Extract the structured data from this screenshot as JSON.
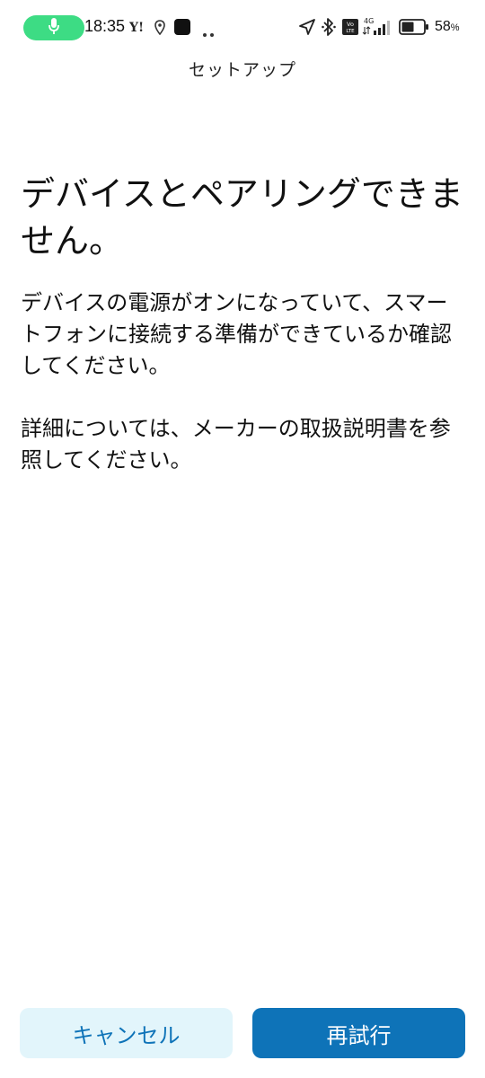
{
  "status_bar": {
    "time": "18:35",
    "battery_percent": "58",
    "battery_unit": "%",
    "network_label": "4G",
    "volte_label": "Vo LTE",
    "notification_icons": [
      "mic-icon",
      "yahoo-icon",
      "location-pin-icon",
      "app-square-icon",
      "more-dots-icon"
    ],
    "system_icons": [
      "navigation-arrow-icon",
      "bluetooth-icon",
      "volte-icon",
      "signal-icon",
      "battery-icon"
    ],
    "mic_pill_color": "#3ddc84"
  },
  "header": {
    "title": "セットアップ"
  },
  "main": {
    "heading": "デバイスとペアリングできません。",
    "paragraph_1": "デバイスの電源がオンになっていて、スマートフォンに接続する準備ができているか確認してください。",
    "paragraph_2": "詳細については、メーカーの取扱説明書を参照してください。"
  },
  "buttons": {
    "cancel_label": "キャンセル",
    "retry_label": "再試行"
  },
  "colors": {
    "accent": "#0e73b8",
    "cancel_bg": "#e2f5fb",
    "text": "#111111",
    "background": "#ffffff"
  }
}
